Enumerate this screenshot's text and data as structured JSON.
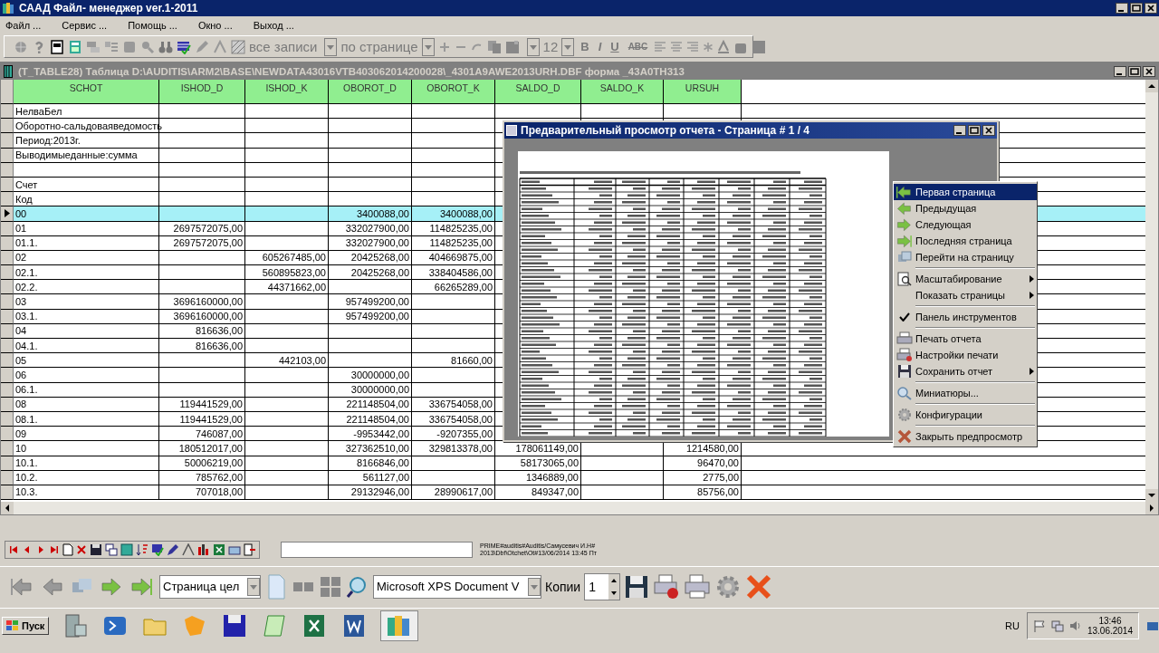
{
  "window": {
    "title": "СААД Файл- менеджер ver.1-2011"
  },
  "menu": [
    "Файл ...",
    "Сервис ...",
    "Помощь ...",
    "Окно ...",
    "Выход ..."
  ],
  "toolbar": {
    "filter_combo": {
      "value": "все записи",
      "disabled": true
    },
    "paging_combo": {
      "value": "по странице",
      "disabled": true
    },
    "font_size": {
      "value": "12",
      "disabled": true
    },
    "format_buttons": [
      {
        "label": "B",
        "disabled": true
      },
      {
        "label": "I",
        "disabled": true
      },
      {
        "label": "U",
        "disabled": true
      },
      {
        "label": "ABC",
        "disabled": true
      }
    ]
  },
  "table_window": {
    "title": "(T_TABLE28)  Таблица D:\\AUDITIS\\ARM2\\BASE\\NEWDATA43016VTB403062014200028\\_4301A9AWE2013URH.DBF форма _43A0TH313"
  },
  "table": {
    "columns": [
      "SCHOT",
      "ISHOD_D",
      "ISHOD_K",
      "OBOROT_D",
      "OBOROT_K",
      "SALDO_D",
      "SALDO_K",
      "URSUH"
    ],
    "rows": [
      {
        "selected": false,
        "cells": [
          "НелваБел",
          null,
          null,
          null,
          null,
          null,
          null,
          null
        ]
      },
      {
        "selected": false,
        "cells": [
          "Оборотно-сальдоваяведомость",
          null,
          null,
          null,
          null,
          null,
          null,
          null
        ]
      },
      {
        "selected": false,
        "cells": [
          "Период:2013г.",
          null,
          null,
          null,
          null,
          null,
          null,
          null
        ]
      },
      {
        "selected": false,
        "cells": [
          "Выводимыеданные:сумма",
          null,
          null,
          null,
          null,
          null,
          null,
          null
        ]
      },
      {
        "selected": false,
        "cells": [
          null,
          null,
          null,
          null,
          null,
          null,
          null,
          null
        ]
      },
      {
        "selected": false,
        "cells": [
          "Счет",
          null,
          null,
          null,
          null,
          null,
          null,
          null
        ]
      },
      {
        "selected": false,
        "cells": [
          "Код",
          null,
          null,
          null,
          null,
          null,
          null,
          null
        ]
      },
      {
        "selected": true,
        "cells": [
          "00",
          null,
          null,
          "3400088,00",
          "3400088,00",
          null,
          null,
          null
        ]
      },
      {
        "selected": false,
        "cells": [
          "01",
          "2697572075,00",
          null,
          "332027900,00",
          "114825235,00",
          null,
          null,
          null
        ]
      },
      {
        "selected": false,
        "cells": [
          "01.1.",
          "2697572075,00",
          null,
          "332027900,00",
          "114825235,00",
          null,
          null,
          null
        ]
      },
      {
        "selected": false,
        "cells": [
          "02",
          null,
          "605267485,00",
          "20425268,00",
          "404669875,00",
          null,
          null,
          null
        ]
      },
      {
        "selected": false,
        "cells": [
          "02.1.",
          null,
          "560895823,00",
          "20425268,00",
          "338404586,00",
          null,
          null,
          null
        ]
      },
      {
        "selected": false,
        "cells": [
          "02.2.",
          null,
          "44371662,00",
          null,
          "66265289,00",
          null,
          null,
          null
        ]
      },
      {
        "selected": false,
        "cells": [
          "03",
          "3696160000,00",
          null,
          "957499200,00",
          null,
          null,
          null,
          null
        ]
      },
      {
        "selected": false,
        "cells": [
          "03.1.",
          "3696160000,00",
          null,
          "957499200,00",
          null,
          null,
          null,
          null
        ]
      },
      {
        "selected": false,
        "cells": [
          "04",
          "816636,00",
          null,
          null,
          null,
          null,
          null,
          null
        ]
      },
      {
        "selected": false,
        "cells": [
          "04.1.",
          "816636,00",
          null,
          null,
          null,
          null,
          null,
          null
        ]
      },
      {
        "selected": false,
        "cells": [
          "05",
          null,
          "442103,00",
          null,
          "81660,00",
          null,
          null,
          null
        ]
      },
      {
        "selected": false,
        "cells": [
          "06",
          null,
          null,
          "30000000,00",
          null,
          null,
          null,
          null
        ]
      },
      {
        "selected": false,
        "cells": [
          "06.1.",
          null,
          null,
          "30000000,00",
          null,
          null,
          null,
          null
        ]
      },
      {
        "selected": false,
        "cells": [
          "08",
          "119441529,00",
          null,
          "221148504,00",
          "336754058,00",
          null,
          null,
          null
        ]
      },
      {
        "selected": false,
        "cells": [
          "08.1.",
          "119441529,00",
          null,
          "221148504,00",
          "336754058,00",
          null,
          null,
          null
        ]
      },
      {
        "selected": false,
        "cells": [
          "09",
          "746087,00",
          null,
          "-9953442,00",
          "-9207355,00",
          null,
          null,
          null
        ]
      },
      {
        "selected": false,
        "cells": [
          "10",
          "180512017,00",
          null,
          "327362510,00",
          "329813378,00",
          "178061149,00",
          null,
          "1214580,00"
        ]
      },
      {
        "selected": false,
        "cells": [
          "10.1.",
          "50006219,00",
          null,
          "8166846,00",
          null,
          "58173065,00",
          null,
          "96470,00"
        ]
      },
      {
        "selected": false,
        "cells": [
          "10.2.",
          "785762,00",
          null,
          "561127,00",
          null,
          "1346889,00",
          null,
          "2775,00"
        ]
      },
      {
        "selected": false,
        "cells": [
          "10.3.",
          "707018,00",
          null,
          "29132946,00",
          "28990617,00",
          "849347,00",
          null,
          "85756,00"
        ]
      }
    ]
  },
  "status": {
    "lines": [
      "PRIME#auditis#Auditis/Самусевич И.Н#",
      "2013\\Dbf\\Otchet\\Ot#13/06/2014 13:45 Пт"
    ]
  },
  "preview_toolbar": {
    "page_mode": "Страница цел",
    "printer": "Microsoft XPS Document V",
    "copies_label": "Копии",
    "copies": "1"
  },
  "preview_window": {
    "title": "Предварительный просмотр отчета - Страница # 1 / 4"
  },
  "context_menu": {
    "items": [
      {
        "kind": "item",
        "label": "Первая страница",
        "selected": true,
        "submenu": false,
        "checked": false
      },
      {
        "kind": "item",
        "label": "Предыдущая",
        "selected": false,
        "submenu": false,
        "checked": false
      },
      {
        "kind": "item",
        "label": "Следующая",
        "selected": false,
        "submenu": false,
        "checked": false
      },
      {
        "kind": "item",
        "label": "Последняя страница",
        "selected": false,
        "submenu": false,
        "checked": false
      },
      {
        "kind": "item",
        "label": "Перейти на страницу",
        "selected": false,
        "submenu": false,
        "checked": false
      },
      {
        "kind": "separator"
      },
      {
        "kind": "item",
        "label": "Масштабирование",
        "selected": false,
        "submenu": true,
        "checked": false
      },
      {
        "kind": "item",
        "label": "Показать страницы",
        "selected": false,
        "submenu": true,
        "checked": false
      },
      {
        "kind": "separator"
      },
      {
        "kind": "item",
        "label": "Панель инструментов",
        "selected": false,
        "submenu": false,
        "checked": true
      },
      {
        "kind": "separator"
      },
      {
        "kind": "item",
        "label": "Печать отчета",
        "selected": false,
        "submenu": false,
        "checked": false
      },
      {
        "kind": "item",
        "label": "Настройки печати",
        "selected": false,
        "submenu": false,
        "checked": false
      },
      {
        "kind": "item",
        "label": "Сохранить отчет",
        "selected": false,
        "submenu": true,
        "checked": false
      },
      {
        "kind": "separator"
      },
      {
        "kind": "item",
        "label": "Миниатюры...",
        "selected": false,
        "submenu": false,
        "checked": false
      },
      {
        "kind": "separator"
      },
      {
        "kind": "item",
        "label": "Конфигурации",
        "selected": false,
        "submenu": false,
        "checked": false
      },
      {
        "kind": "separator"
      },
      {
        "kind": "item",
        "label": "Закрыть предпросмотр",
        "selected": false,
        "submenu": false,
        "checked": false
      }
    ]
  },
  "taskbar": {
    "start": "Пуск",
    "language": "RU",
    "time": "13:46",
    "date": "13.06.2014"
  }
}
